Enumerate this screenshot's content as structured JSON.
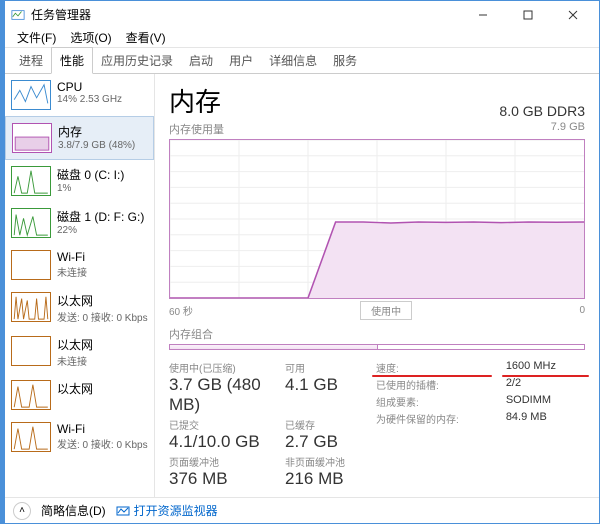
{
  "window": {
    "title": "任务管理器"
  },
  "menu": {
    "file": "文件(F)",
    "options": "选项(O)",
    "view": "查看(V)"
  },
  "tabs": [
    "进程",
    "性能",
    "应用历史记录",
    "启动",
    "用户",
    "详细信息",
    "服务"
  ],
  "active_tab": 1,
  "sidebar": {
    "items": [
      {
        "title": "CPU",
        "sub": "14% 2.53 GHz",
        "color": "#3b8bd0"
      },
      {
        "title": "内存",
        "sub": "3.8/7.9 GB (48%)",
        "color": "#b153b1"
      },
      {
        "title": "磁盘 0 (C: I:)",
        "sub": "1%",
        "color": "#3a9a3a"
      },
      {
        "title": "磁盘 1 (D: F: G:)",
        "sub": "22%",
        "color": "#3a9a3a"
      },
      {
        "title": "Wi-Fi",
        "sub": "未连接",
        "color": "#b86b1a"
      },
      {
        "title": "以太网",
        "sub": "发送: 0 接收: 0 Kbps",
        "color": "#b86b1a"
      },
      {
        "title": "以太网",
        "sub": "未连接",
        "color": "#b86b1a"
      },
      {
        "title": "以太网",
        "sub": "",
        "color": "#b86b1a"
      },
      {
        "title": "Wi-Fi",
        "sub": "发送: 0 接收: 0 Kbps",
        "color": "#b86b1a"
      }
    ],
    "selected": 1
  },
  "main": {
    "title": "内存",
    "type": "8.0 GB DDR3",
    "chart_label": "内存使用量",
    "chart_max": "7.9 GB",
    "axis_left": "60 秒",
    "axis_right": "0",
    "axis_mid": "使用中",
    "slots_label": "内存组合",
    "stats": {
      "used_label": "使用中(已压缩)",
      "used_value": "3.7 GB (480 MB)",
      "avail_label": "可用",
      "avail_value": "4.1 GB",
      "committed_label": "已提交",
      "committed_value": "4.1/10.0 GB",
      "cached_label": "已缓存",
      "cached_value": "2.7 GB",
      "paged_label": "页面缓冲池",
      "paged_value": "376 MB",
      "nonpaged_label": "非页面缓冲池",
      "nonpaged_value": "216 MB"
    },
    "right": {
      "speed_k": "速度:",
      "speed_v": "1600 MHz",
      "slots_k": "已使用的插槽:",
      "slots_v": "2/2",
      "form_k": "组成要素:",
      "form_v": "SODIMM",
      "hw_k": "为硬件保留的内存:",
      "hw_v": "84.9 MB"
    }
  },
  "footer": {
    "less": "简略信息(D)",
    "resmon": "打开资源监视器"
  },
  "chart_data": {
    "type": "area",
    "title": "内存使用量",
    "ylabel": "GB",
    "ylim": [
      0,
      7.9
    ],
    "xlabel": "秒",
    "xlim": [
      60,
      0
    ],
    "x": [
      60,
      56,
      52,
      48,
      44,
      40,
      36,
      32,
      28,
      24,
      20,
      16,
      12,
      8,
      4,
      0
    ],
    "values": [
      0,
      0,
      0,
      0,
      0,
      0,
      3.8,
      3.8,
      3.75,
      3.8,
      3.78,
      3.8,
      3.77,
      3.8,
      3.79,
      3.8
    ]
  }
}
